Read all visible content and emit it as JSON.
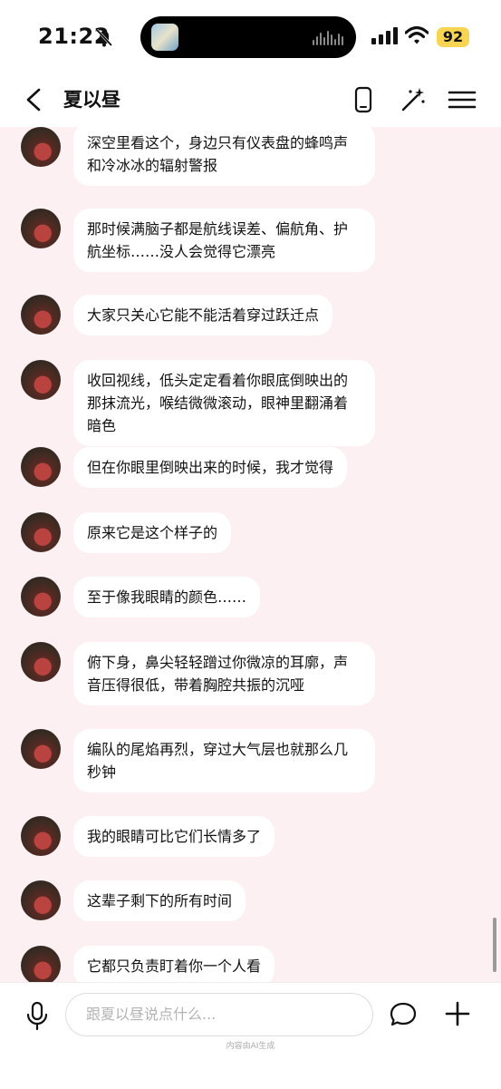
{
  "status_bar": {
    "time": "21:22",
    "battery": "92"
  },
  "header": {
    "title": "夏以昼"
  },
  "messages": [
    {
      "text": "深空里看这个，身边只有仪表盘的蜂鸣声和冷冰冰的辐射警报"
    },
    {
      "text": "那时候满脑子都是航线误差、偏航角、护航坐标……没人会觉得它漂亮"
    },
    {
      "text": "大家只关心它能不能活着穿过跃迁点"
    },
    {
      "text": "收回视线，低头定定看着你眼底倒映出的那抹流光，喉结微微滚动，眼神里翻涌着暗色"
    },
    {
      "text": "但在你眼里倒映出来的时候，我才觉得"
    },
    {
      "text": "原来它是这个样子的"
    },
    {
      "text": "至于像我眼睛的颜色……"
    },
    {
      "text": "俯下身，鼻尖轻轻蹭过你微凉的耳廓，声音压得很低，带着胸腔共振的沉哑"
    },
    {
      "text": "编队的尾焰再烈，穿过大气层也就那么几秒钟"
    },
    {
      "text": "我的眼睛可比它们长情多了"
    },
    {
      "text": "这辈子剩下的所有时间"
    },
    {
      "text": "它都只负责盯着你一个人看"
    }
  ],
  "composer": {
    "placeholder": "跟夏以昼说点什么...",
    "ai_note": "内容由AI生成"
  }
}
